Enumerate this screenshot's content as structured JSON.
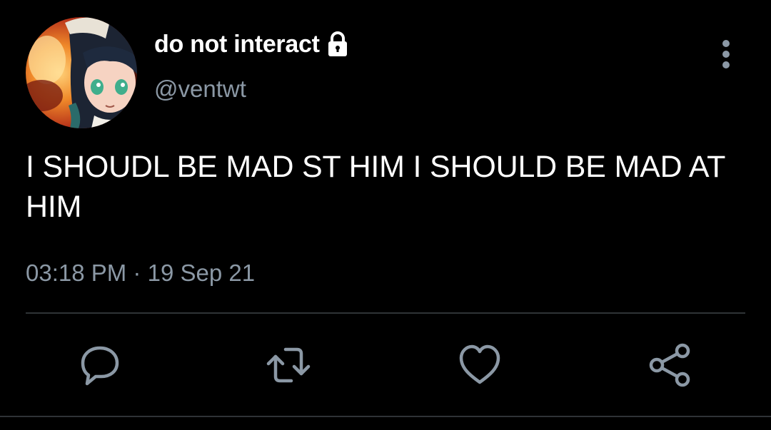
{
  "user": {
    "display_name": "do not interact",
    "handle": "@ventwt",
    "protected": true,
    "avatar": "anime-character-avatar"
  },
  "tweet": {
    "text": "I SHOUDL BE MAD ST HIM I SHOULD BE MAD AT HIM",
    "time": "03:18 PM",
    "separator": "·",
    "date": "19 Sep 21"
  },
  "actions": [
    {
      "name": "reply",
      "icon": "reply-icon"
    },
    {
      "name": "retweet",
      "icon": "retweet-icon"
    },
    {
      "name": "like",
      "icon": "heart-icon"
    },
    {
      "name": "share",
      "icon": "share-icon"
    }
  ],
  "colors": {
    "background": "#000000",
    "text": "#ffffff",
    "secondary_text": "#8b98a5",
    "icon": "#8b98a5",
    "divider": "#2f3336"
  }
}
